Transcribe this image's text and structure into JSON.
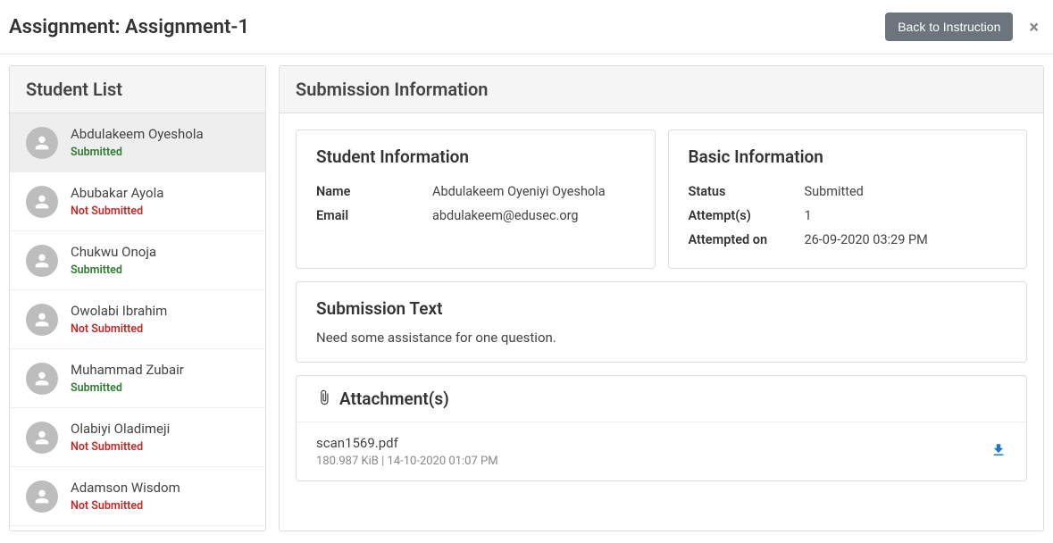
{
  "header": {
    "title_prefix": "Assignment: ",
    "title_name": "Assignment-1",
    "back_button": "Back to Instruction",
    "close_label": "×"
  },
  "sidebar": {
    "title": "Student List",
    "students": [
      {
        "name": "Abdulakeem Oyeshola",
        "status": "Submitted",
        "submitted": true,
        "selected": true
      },
      {
        "name": "Abubakar Ayola",
        "status": "Not Submitted",
        "submitted": false
      },
      {
        "name": "Chukwu Onoja",
        "status": "Submitted",
        "submitted": true
      },
      {
        "name": "Owolabi Ibrahim",
        "status": "Not Submitted",
        "submitted": false
      },
      {
        "name": "Muhammad Zubair",
        "status": "Submitted",
        "submitted": true
      },
      {
        "name": "Olabiyi Oladimeji",
        "status": "Not Submitted",
        "submitted": false
      },
      {
        "name": "Adamson Wisdom",
        "status": "Not Submitted",
        "submitted": false
      }
    ]
  },
  "main": {
    "title": "Submission Information",
    "student_info": {
      "title": "Student Information",
      "name_label": "Name",
      "name_value": "Abdulakeem Oyeniyi Oyeshola",
      "email_label": "Email",
      "email_value": "abdulakeem@edusec.org"
    },
    "basic_info": {
      "title": "Basic Information",
      "status_label": "Status",
      "status_value": "Submitted",
      "attempts_label": "Attempt(s)",
      "attempts_value": "1",
      "attempted_on_label": "Attempted on",
      "attempted_on_value": "26-09-2020 03:29 PM"
    },
    "submission_text": {
      "title": "Submission Text",
      "body": "Need some assistance for one question."
    },
    "attachments": {
      "title": "Attachment(s)",
      "items": [
        {
          "name": "scan1569.pdf",
          "meta": "180.987 KiB | 14-10-2020 01:07 PM"
        }
      ]
    }
  }
}
